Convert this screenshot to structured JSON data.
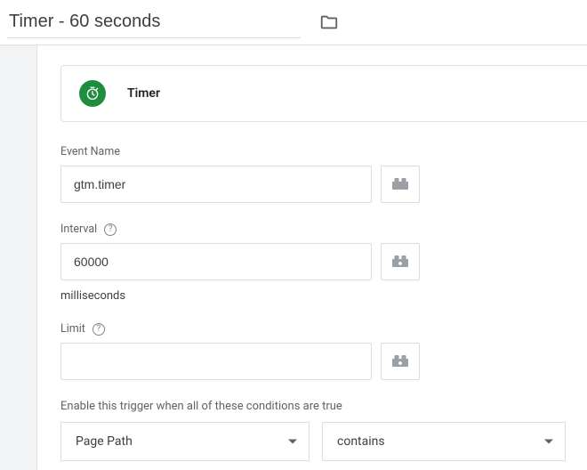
{
  "titlebar": {
    "title": "Timer - 60 seconds"
  },
  "card": {
    "title": "Timer"
  },
  "fields": {
    "eventName": {
      "label": "Event Name",
      "value": "gtm.timer"
    },
    "interval": {
      "label": "Interval",
      "value": "60000",
      "unit": "milliseconds"
    },
    "limit": {
      "label": "Limit",
      "value": ""
    }
  },
  "conditions": {
    "heading": "Enable this trigger when all of these conditions are true",
    "row": {
      "variable": "Page Path",
      "operator": "contains"
    }
  }
}
